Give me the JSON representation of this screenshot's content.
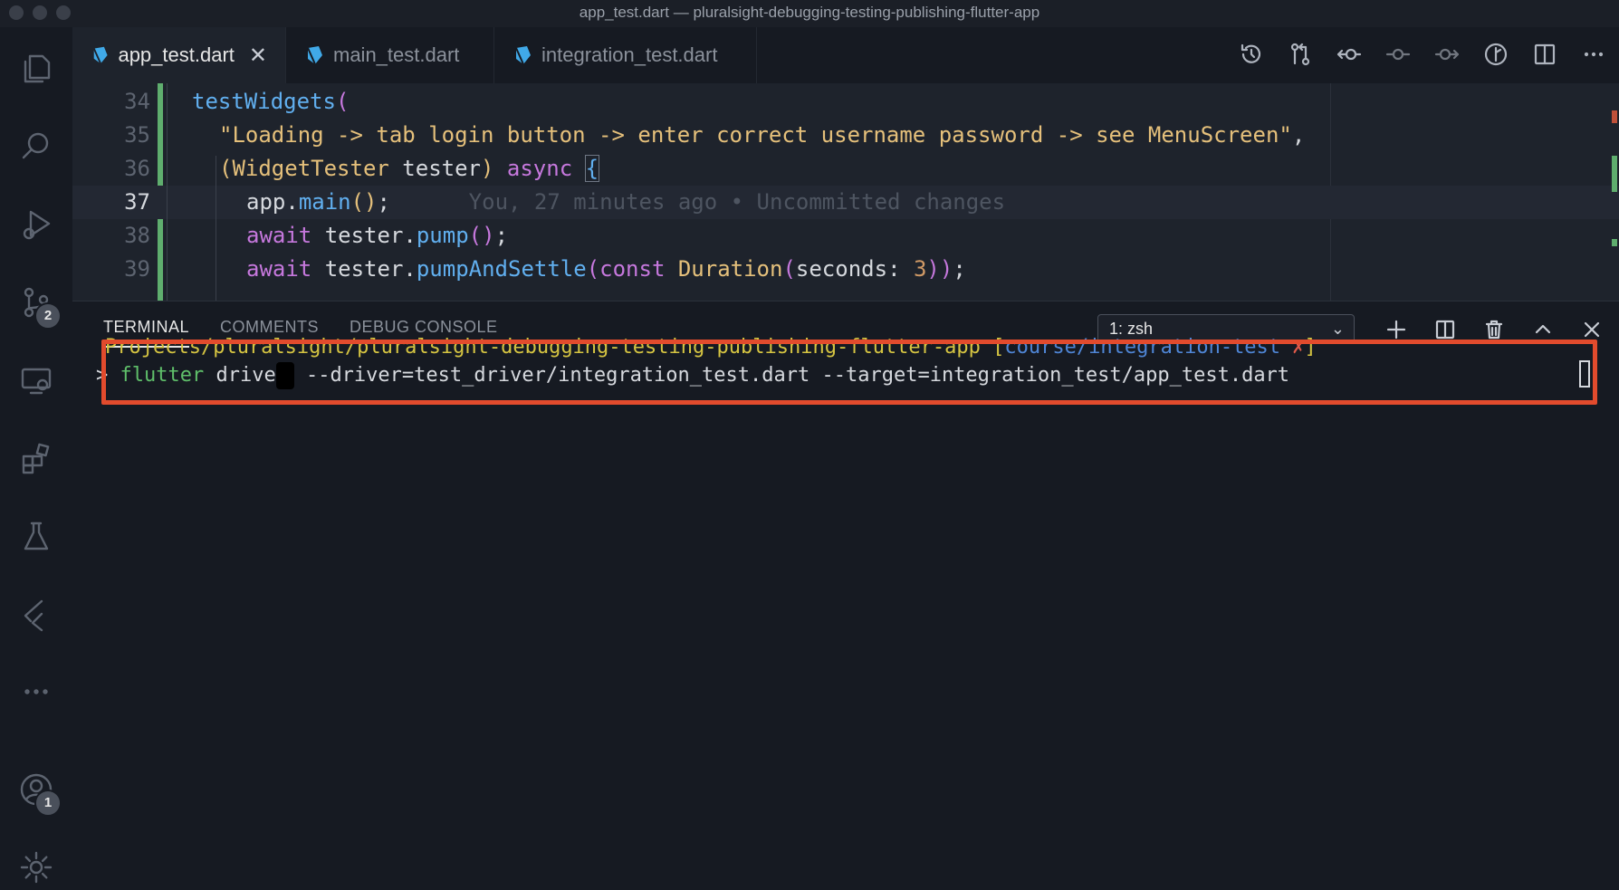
{
  "window": {
    "title": "app_test.dart — pluralsight-debugging-testing-publishing-flutter-app"
  },
  "activity_bar": {
    "scm_badge": "2",
    "accounts_badge": "1"
  },
  "tabs": [
    {
      "label": "app_test.dart",
      "active": true
    },
    {
      "label": "main_test.dart",
      "active": false
    },
    {
      "label": "integration_test.dart",
      "active": false
    }
  ],
  "editor": {
    "current_line": 37,
    "lines": [
      {
        "num": "34",
        "parts": [
          {
            "t": "testWidgets",
            "c": "fn"
          },
          {
            "t": "(",
            "c": "kw"
          }
        ],
        "indent": 1
      },
      {
        "num": "35",
        "parts": [
          {
            "t": "\"Loading -> tab login button -> enter correct username password -> see MenuScreen\"",
            "c": "str"
          },
          {
            "t": ",",
            "c": "plain"
          }
        ],
        "indent": 2
      },
      {
        "num": "36",
        "parts": [
          {
            "t": "(",
            "c": "str"
          },
          {
            "t": "WidgetTester",
            "c": "ty"
          },
          {
            "t": " tester",
            "c": "prm"
          },
          {
            "t": ")",
            "c": "str"
          },
          {
            "t": " async ",
            "c": "kw"
          },
          {
            "t": "{",
            "c": "fn"
          }
        ],
        "indent": 2
      },
      {
        "num": "37",
        "parts": [
          {
            "t": "app",
            "c": "plain"
          },
          {
            "t": ".",
            "c": "plain"
          },
          {
            "t": "main",
            "c": "fn"
          },
          {
            "t": "()",
            "c": "ty"
          },
          {
            "t": ";",
            "c": "plain"
          }
        ],
        "indent": 3,
        "blame": "You, 27 minutes ago • Uncommitted changes"
      },
      {
        "num": "38",
        "parts": [
          {
            "t": "await ",
            "c": "kw"
          },
          {
            "t": "tester",
            "c": "plain"
          },
          {
            "t": ".",
            "c": "plain"
          },
          {
            "t": "pump",
            "c": "fn"
          },
          {
            "t": "()",
            "c": "kw"
          },
          {
            "t": ";",
            "c": "plain"
          }
        ],
        "indent": 3
      },
      {
        "num": "39",
        "parts": [
          {
            "t": "await ",
            "c": "kw"
          },
          {
            "t": "tester",
            "c": "plain"
          },
          {
            "t": ".",
            "c": "plain"
          },
          {
            "t": "pumpAndSettle",
            "c": "fn"
          },
          {
            "t": "(",
            "c": "kw"
          },
          {
            "t": "const ",
            "c": "kw"
          },
          {
            "t": "Duration",
            "c": "ty"
          },
          {
            "t": "(",
            "c": "kw"
          },
          {
            "t": "seconds",
            "c": "prm"
          },
          {
            "t": ": ",
            "c": "plain"
          },
          {
            "t": "3",
            "c": "num"
          },
          {
            "t": "))",
            "c": "kw"
          },
          {
            "t": ";",
            "c": "plain"
          }
        ],
        "indent": 3
      }
    ]
  },
  "panel": {
    "tabs": [
      {
        "label": "TERMINAL",
        "active": true
      },
      {
        "label": "COMMENTS",
        "active": false
      },
      {
        "label": "DEBUG CONSOLE",
        "active": false
      }
    ],
    "terminal_select": "1: zsh",
    "terminal": {
      "path": "Projects/pluralsight/pluralsight-debugging-testing-publishing-flutter-app",
      "branch_open": " [",
      "branch": "course/integration-test",
      "dirty": " ✗",
      "branch_close": "]",
      "prompt": ">",
      "cmd_name": "flutter",
      "cmd_sub": " drive",
      "cmd_args": " --driver=test_driver/integration_test.dart --target=integration_test/app_test.dart"
    }
  },
  "colors": {
    "highlight_box": "#e24b2d",
    "git_added": "#5fae6e",
    "path_yellow": "#d6c542",
    "branch_blue": "#4f86d6"
  }
}
